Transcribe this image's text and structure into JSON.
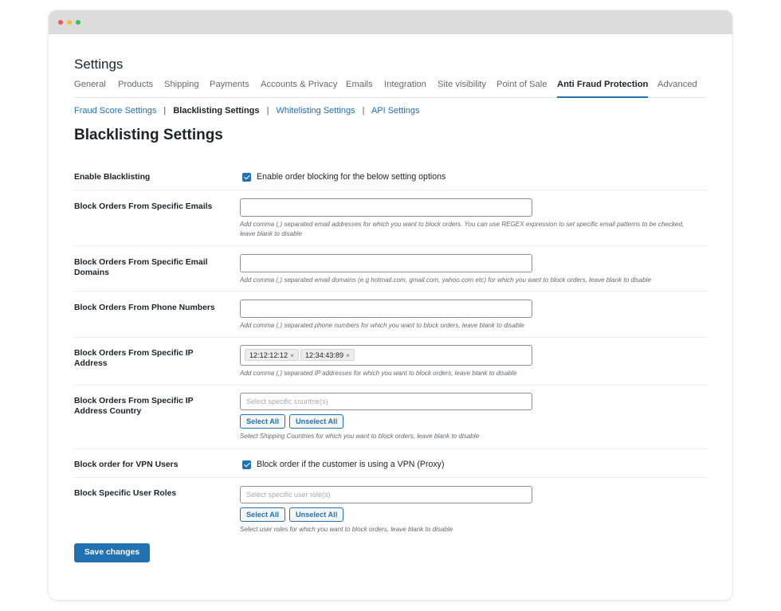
{
  "page": {
    "title": "Settings"
  },
  "tabs": [
    {
      "label": "General"
    },
    {
      "label": "Products"
    },
    {
      "label": "Shipping"
    },
    {
      "label": "Payments"
    },
    {
      "label": "Accounts & Privacy"
    },
    {
      "label": "Emails"
    },
    {
      "label": "Integration"
    },
    {
      "label": "Site visibility"
    },
    {
      "label": "Point of Sale"
    },
    {
      "label": "Anti Fraud Protection",
      "active": true
    },
    {
      "label": "Advanced"
    }
  ],
  "subnav": {
    "items": [
      "Fraud Score Settings",
      "Blacklisting Settings",
      "Whitelisting Settings",
      "API Settings"
    ],
    "current": "Blacklisting Settings",
    "separator": "|"
  },
  "section": {
    "title": "Blacklisting Settings"
  },
  "fields": {
    "enable_blacklisting": {
      "label": "Enable Blacklisting",
      "checkbox_label": "Enable order blocking for the below setting options",
      "checked": true
    },
    "emails": {
      "label": "Block Orders From Specific Emails",
      "value": "",
      "description": "Add comma (,) separated email addresses for which you want to block orders. You can use REGEX expression to set specific email patterns to be checked, leave blank to disable"
    },
    "email_domains": {
      "label": "Block Orders From Specific Email Domains",
      "value": "",
      "description": "Add comma (,) separated email domains (e.g hotmail.com, gmail.com, yahoo.com etc) for which you want to block orders, leave blank to disable"
    },
    "phone_numbers": {
      "label": "Block Orders From Phone Numbers",
      "value": "",
      "description": "Add comma (,) separated phone numbers for which you want to block orders, leave blank to disable"
    },
    "ip_address": {
      "label": "Block Orders From Specific IP Address",
      "tags": [
        "12:12:12:12",
        "12:34:43:89"
      ],
      "remove_symbol": "×",
      "description": "Add comma (,) separated IP addresses for which you want to block orders, leave blank to disable"
    },
    "ip_country": {
      "label": "Block Orders From Specific IP Address Country",
      "placeholder": "Select specific countrie(s)",
      "select_all": "Select All",
      "unselect_all": "Unselect All",
      "description": "Select Shipping Countries for which you want to block orders, leave blank to disable"
    },
    "vpn_users": {
      "label": "Block order for VPN Users",
      "checkbox_label": "Block order if the customer is using a VPN (Proxy)",
      "checked": true
    },
    "user_roles": {
      "label": "Block Specific User Roles",
      "placeholder": "Select specific user role(s)",
      "select_all": "Select All",
      "unselect_all": "Unselect All",
      "description": "Select user roles for which you want to block orders, leave blank to disable"
    }
  },
  "actions": {
    "save_label": "Save changes"
  },
  "colors": {
    "accent": "#2271b1",
    "titlebar": "#dcdcdc"
  }
}
